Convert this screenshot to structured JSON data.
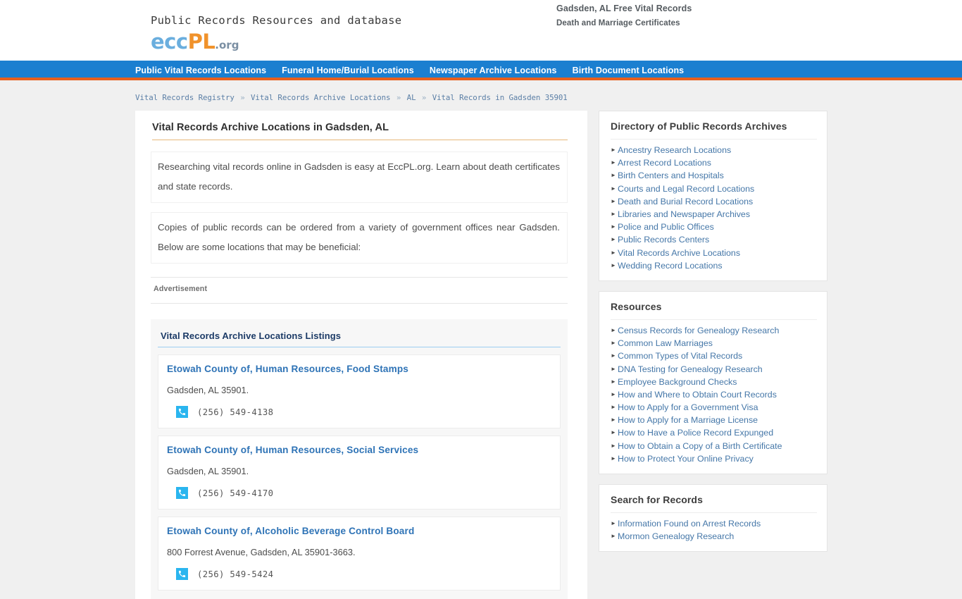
{
  "header": {
    "tagline": "Public Records Resources and database",
    "logo": {
      "part1": "ecc",
      "part2": "PL",
      "part3": ".org"
    },
    "right_line1": "Gadsden, AL Free Vital Records",
    "right_line2": "Death and Marriage Certificates",
    "colors": {
      "nav_blue": "#1b7fd0",
      "accent_orange": "#e8601c",
      "logo_blue": "#6aaede",
      "logo_orange": "#f0922b",
      "phone_icon": "#2ab5ef",
      "link_blue": "#4577a8"
    }
  },
  "nav": {
    "items": [
      {
        "label": "Public Vital Records Locations"
      },
      {
        "label": "Funeral Home/Burial Locations"
      },
      {
        "label": "Newspaper Archive Locations"
      },
      {
        "label": "Birth Document Locations"
      }
    ]
  },
  "breadcrumb": {
    "items": [
      "Vital Records Registry",
      "Vital Records Archive Locations",
      "AL",
      "Vital Records in Gadsden 35901"
    ],
    "separator": "»"
  },
  "main": {
    "title": "Vital Records Archive Locations in Gadsden, AL",
    "intro_1": "Researching vital records online in Gadsden is easy at EccPL.org. Learn about death certificates and state records.",
    "intro_2": "Copies of public records can be ordered from a variety of government offices near Gadsden. Below are some locations that may be beneficial:",
    "ad_label": "Advertisement",
    "listings_title": "Vital Records Archive Locations Listings",
    "listings": [
      {
        "name": "Etowah County of, Human Resources, Food Stamps",
        "address": "Gadsden, AL 35901.",
        "phone": "(256) 549-4138"
      },
      {
        "name": "Etowah County of, Human Resources, Social Services",
        "address": "Gadsden, AL 35901.",
        "phone": "(256) 549-4170"
      },
      {
        "name": "Etowah County of, Alcoholic Beverage Control Board",
        "address": "800 Forrest Avenue, Gadsden, AL 35901-3663.",
        "phone": "(256) 549-5424"
      }
    ]
  },
  "sidebar": {
    "cards": [
      {
        "title": "Directory of Public Records Archives",
        "links": [
          "Ancestry Research Locations",
          "Arrest Record Locations",
          "Birth Centers and Hospitals",
          "Courts and Legal Record Locations",
          "Death and Burial Record Locations",
          "Libraries and Newspaper Archives",
          "Police and Public Offices",
          "Public Records Centers",
          "Vital Records Archive Locations",
          "Wedding Record Locations"
        ]
      },
      {
        "title": "Resources",
        "links": [
          "Census Records for Genealogy Research",
          "Common Law Marriages",
          "Common Types of Vital Records",
          "DNA Testing for Genealogy Research",
          "Employee Background Checks",
          "How and Where to Obtain Court Records",
          "How to Apply for a Government Visa",
          "How to Apply for a Marriage License",
          "How to Have a Police Record Expunged",
          "How to Obtain a Copy of a Birth Certificate",
          "How to Protect Your Online Privacy"
        ]
      },
      {
        "title": "Search for Records",
        "links": [
          "Information Found on Arrest Records",
          "Mormon Genealogy Research"
        ]
      }
    ]
  }
}
